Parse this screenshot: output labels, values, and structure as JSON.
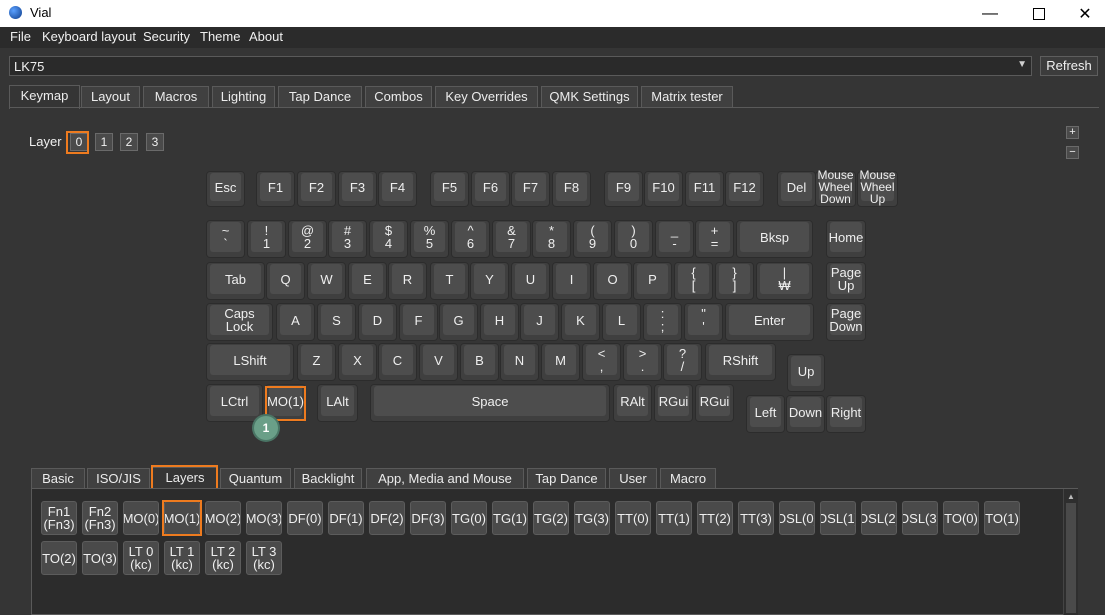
{
  "window": {
    "title": "Vial"
  },
  "menu": [
    "File",
    "Keyboard layout",
    "Security",
    "Theme",
    "About"
  ],
  "device": {
    "selected": "LK75",
    "refresh_label": "Refresh"
  },
  "main_tabs": [
    "Keymap",
    "Layout",
    "Macros",
    "Lighting",
    "Tap Dance",
    "Combos",
    "Key Overrides",
    "QMK Settings",
    "Matrix tester"
  ],
  "main_tab_active": "Keymap",
  "layer": {
    "label": "Layer",
    "buttons": [
      "0",
      "1",
      "2",
      "3"
    ],
    "selected": "0"
  },
  "zoom": {
    "plus": "+",
    "minus": "−"
  },
  "keyboard": {
    "rows": [
      [
        "Esc",
        "F1",
        "F2",
        "F3",
        "F4",
        "F5",
        "F6",
        "F7",
        "F8",
        "F9",
        "F10",
        "F11",
        "F12",
        "Del",
        "Mouse\nWheel\nDown",
        "Mouse\nWheel\nUp"
      ],
      [
        "~\n`",
        "!\n1",
        "@\n2",
        "#\n3",
        "$\n4",
        "%\n5",
        "^\n6",
        "&\n7",
        "*\n8",
        "(\n9",
        ")\n0",
        "_\n-",
        "+\n=",
        "Bksp",
        "Home"
      ],
      [
        "Tab",
        "Q",
        "W",
        "E",
        "R",
        "T",
        "Y",
        "U",
        "I",
        "O",
        "P",
        "{\n[",
        "}\n]",
        "|\n₩",
        "Page\nUp"
      ],
      [
        "Caps\nLock",
        "A",
        "S",
        "D",
        "F",
        "G",
        "H",
        "J",
        "K",
        "L",
        ":\n;",
        "\"\n'",
        "Enter",
        "Page\nDown"
      ],
      [
        "LShift",
        "Z",
        "X",
        "C",
        "V",
        "B",
        "N",
        "M",
        "<\n,",
        ">\n.",
        "?\n/",
        "RShift",
        "Up"
      ],
      [
        "LCtrl",
        "MO(1)",
        "LAlt",
        "Space",
        "RAlt",
        "RGui",
        "RGui",
        "Left",
        "Down",
        "Right"
      ]
    ],
    "selected_key": "MO(1)",
    "badge": "1"
  },
  "bottom_tabs": [
    "Basic",
    "ISO/JIS",
    "Layers",
    "Quantum",
    "Backlight",
    "App, Media and Mouse",
    "Tap Dance",
    "User",
    "Macro"
  ],
  "bottom_tab_active": "Layers",
  "layer_keys": {
    "row1": [
      "Fn1\n(Fn3)",
      "Fn2\n(Fn3)",
      "MO(0)",
      "MO(1)",
      "MO(2)",
      "MO(3)",
      "DF(0)",
      "DF(1)",
      "DF(2)",
      "DF(3)",
      "TG(0)",
      "TG(1)",
      "TG(2)",
      "TG(3)",
      "TT(0)",
      "TT(1)",
      "TT(2)",
      "TT(3)",
      "OSL(0)",
      "OSL(1)",
      "OSL(2)",
      "OSL(3)",
      "TO(0)",
      "TO(1)"
    ],
    "row2": [
      "TO(2)",
      "TO(3)",
      "LT 0\n(kc)",
      "LT 1\n(kc)",
      "LT 2\n(kc)",
      "LT 3\n(kc)"
    ],
    "selected": "MO(1)"
  },
  "colors": {
    "highlight": "#ee7b1f",
    "badge": "#6a9f88",
    "background": "#353535"
  }
}
